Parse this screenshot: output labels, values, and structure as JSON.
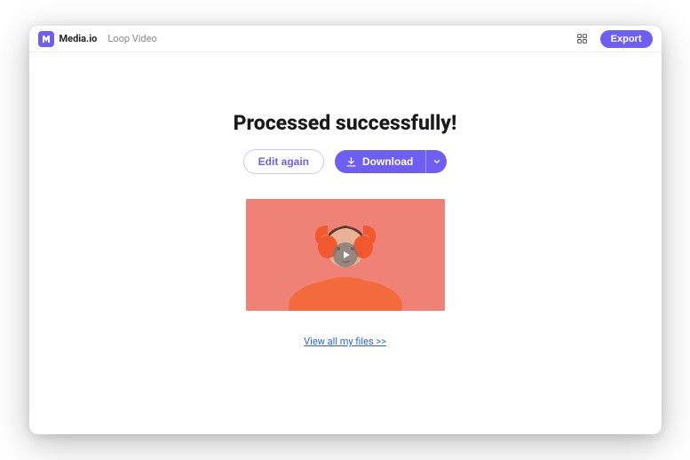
{
  "header": {
    "brand": "Media.io",
    "tool": "Loop Video",
    "export_label": "Export"
  },
  "main": {
    "title": "Processed successfully!",
    "edit_label": "Edit again",
    "download_label": "Download",
    "files_link": "View all my files >>"
  },
  "colors": {
    "accent": "#6f5ef2",
    "link": "#2a63d6",
    "video_bg": "#f08176"
  }
}
